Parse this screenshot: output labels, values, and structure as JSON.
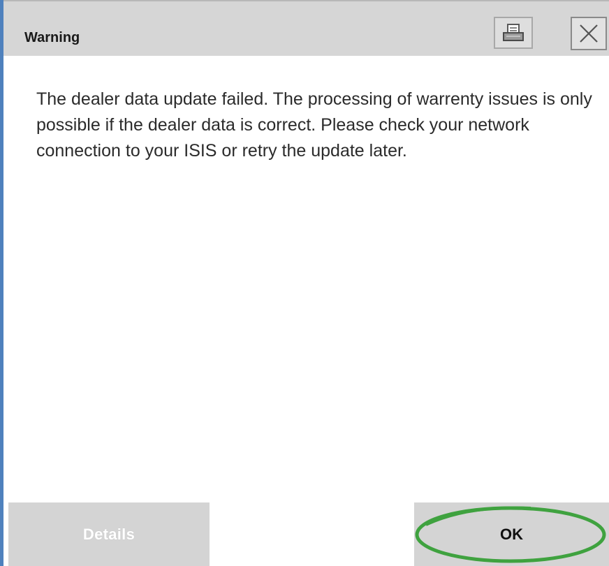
{
  "dialog": {
    "title": "Warning",
    "message": "The dealer data update failed. The processing of warrenty issues is only possible if the dealer data is correct. Please check your network connection to your ISIS or retry the update later.",
    "buttons": {
      "details_label": "Details",
      "ok_label": "OK"
    },
    "icons": {
      "print": "printer-icon",
      "close": "close-icon"
    }
  },
  "colors": {
    "title_bar": "#d6d6d6",
    "button_bg": "#d4d4d4",
    "highlight_ring": "#3fa23f",
    "left_accent": "#4f81bd"
  }
}
